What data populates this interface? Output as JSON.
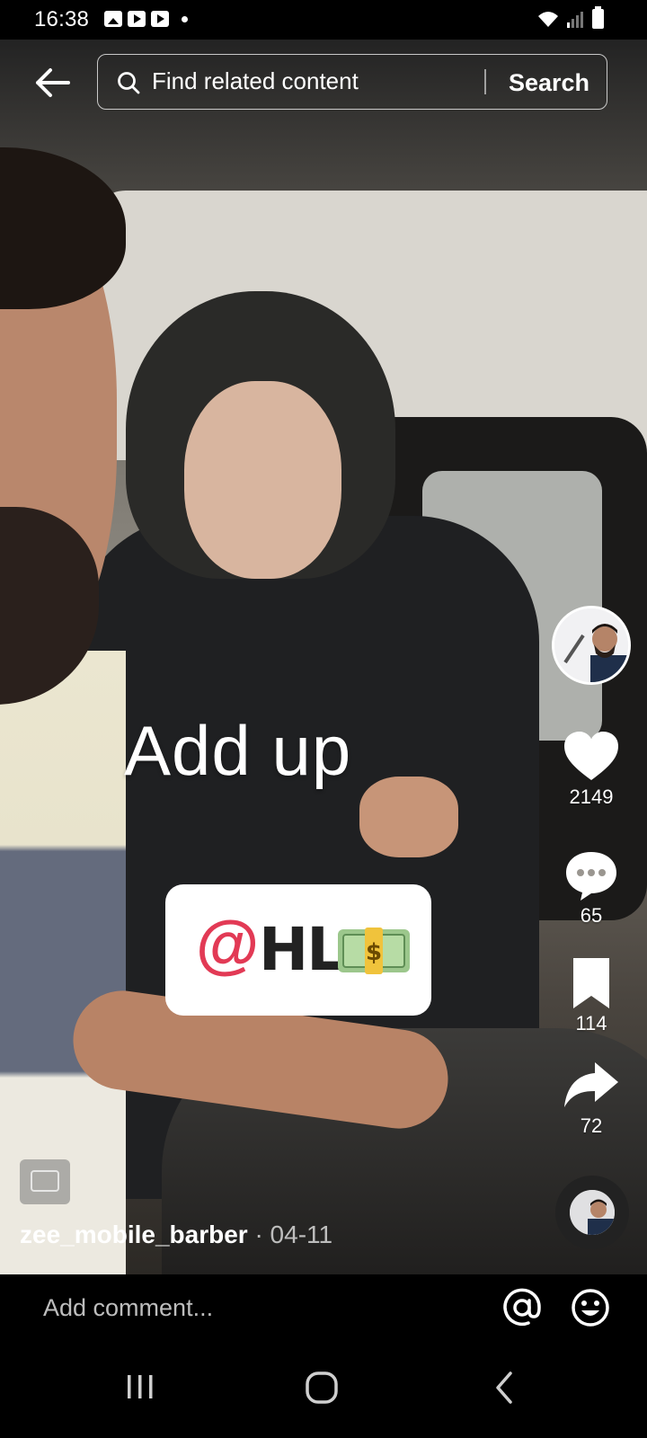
{
  "status_bar": {
    "time": "16:38"
  },
  "search": {
    "placeholder": "Find related content",
    "button_label": "Search"
  },
  "video": {
    "caption": "Add up",
    "mention_at": "@",
    "mention_handle": "HL",
    "author": "zee_mobile_barber",
    "date": "· 04-11"
  },
  "actions": {
    "likes": "2149",
    "comments": "65",
    "saves": "114",
    "shares": "72"
  },
  "comment_bar": {
    "placeholder": "Add comment..."
  },
  "icons": {
    "back": "back-arrow-icon",
    "search": "search-icon",
    "like": "heart-icon",
    "comment": "comment-bubble-icon",
    "save": "bookmark-icon",
    "share": "share-arrow-icon",
    "mention": "at-icon",
    "emoji": "emoji-icon"
  }
}
